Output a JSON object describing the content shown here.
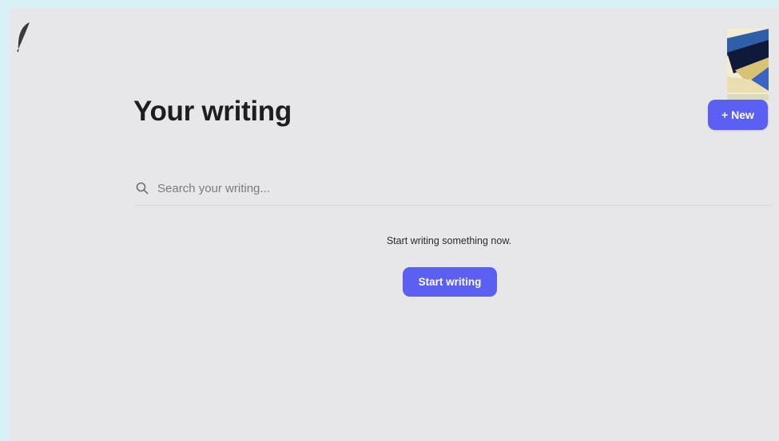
{
  "header": {
    "logo_icon": "feather-quill-icon",
    "avatar_icon": "user-avatar-image",
    "new_button_label": "+ New"
  },
  "main": {
    "title": "Your writing",
    "search": {
      "placeholder": "Search your writing...",
      "value": "",
      "icon": "search-icon"
    },
    "empty_state": {
      "message": "Start writing something now.",
      "button_label": "Start writing"
    }
  },
  "colors": {
    "accent": "#5b5ff2",
    "background": "#e7e7e9",
    "outer_background": "#d9f0f7",
    "title_text": "#1d1d22"
  }
}
